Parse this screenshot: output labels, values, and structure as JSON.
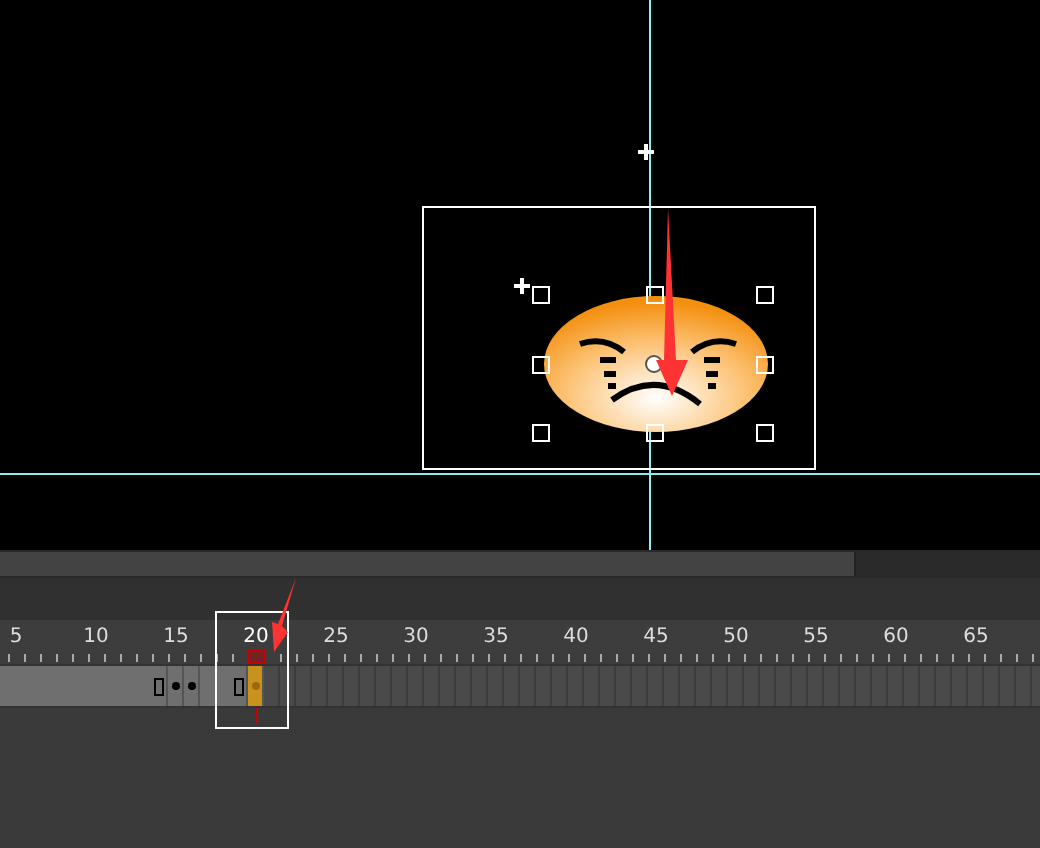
{
  "stage": {
    "selected": true
  },
  "timeline": {
    "ruler": [
      {
        "label": "5",
        "selected": false
      },
      {
        "label": "10",
        "selected": false
      },
      {
        "label": "15",
        "selected": false
      },
      {
        "label": "20",
        "selected": true
      },
      {
        "label": "25",
        "selected": false
      },
      {
        "label": "30",
        "selected": false
      },
      {
        "label": "35",
        "selected": false
      },
      {
        "label": "40",
        "selected": false
      },
      {
        "label": "45",
        "selected": false
      },
      {
        "label": "50",
        "selected": false
      },
      {
        "label": "55",
        "selected": false
      },
      {
        "label": "60",
        "selected": false
      },
      {
        "label": "65",
        "selected": false
      }
    ],
    "frames": [
      {
        "kind": "span"
      },
      {
        "kind": "span"
      },
      {
        "kind": "span"
      },
      {
        "kind": "span"
      },
      {
        "kind": "span"
      },
      {
        "kind": "span"
      },
      {
        "kind": "span"
      },
      {
        "kind": "span"
      },
      {
        "kind": "span"
      },
      {
        "kind": "span"
      },
      {
        "kind": "empty-keyframe"
      },
      {
        "kind": "keyframe"
      },
      {
        "kind": "keyframe"
      },
      {
        "kind": "span"
      },
      {
        "kind": "span"
      },
      {
        "kind": "empty-keyframe"
      },
      {
        "kind": "current"
      }
    ]
  }
}
